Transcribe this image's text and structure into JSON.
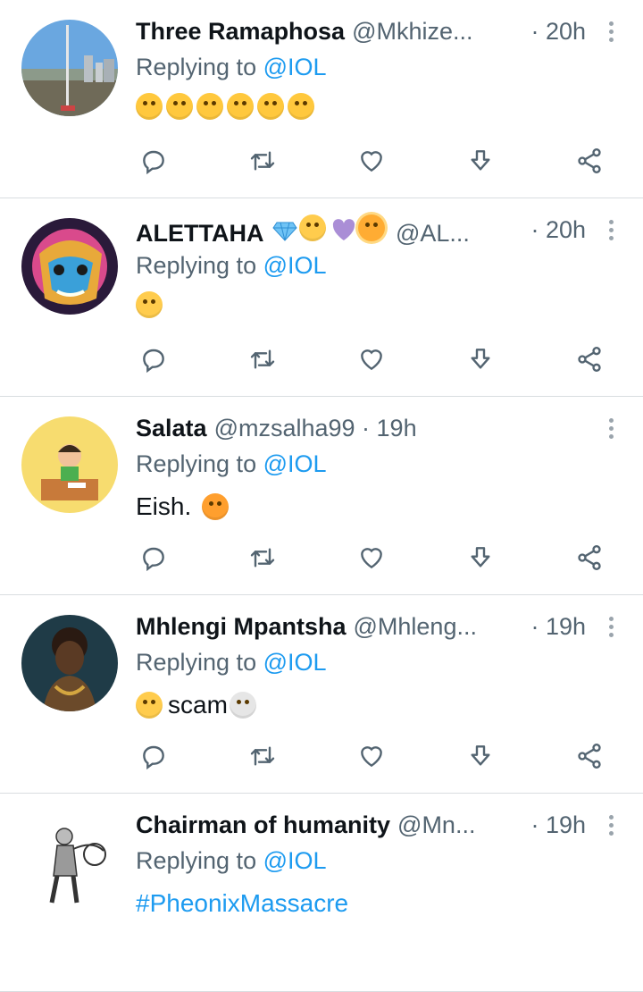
{
  "tweets": [
    {
      "name": "Three Ramaphosa",
      "handle": "@Mkhize...",
      "time": "· 20h",
      "reply_prefix": "Replying to",
      "reply_to": "@IOL",
      "body_text": "",
      "body_emojis": [
        "rolling-on-floor-laughing",
        "rolling-on-floor-laughing",
        "rolling-on-floor-laughing",
        "rolling-on-floor-laughing",
        "rolling-on-floor-laughing",
        "rolling-on-floor-laughing"
      ]
    },
    {
      "name": "ALETTAHA",
      "handle": "@AL...",
      "time": "· 20h",
      "reply_prefix": "Replying to",
      "reply_to": "@IOL",
      "body_text": "",
      "body_emojis": [
        "flushed-face"
      ]
    },
    {
      "name": "Salata",
      "handle": "@mzsalha99 · 19h",
      "time": "",
      "reply_prefix": "Replying to",
      "reply_to": "@IOL",
      "body_text": "Eish.",
      "body_emojis": [
        "face-with-hand-over-mouth"
      ]
    },
    {
      "name": "Mhlengi Mpantsha",
      "handle": "@Mhleng...",
      "time": "· 19h",
      "reply_prefix": "Replying to",
      "reply_to": "@IOL",
      "body_text": "scam",
      "body_emojis": [
        "loudly-crying-face",
        "skull"
      ]
    },
    {
      "name": "Chairman of humanity",
      "handle": "@Mn...",
      "time": "· 19h",
      "reply_prefix": "Replying to",
      "reply_to": "@IOL",
      "body_text": "#PheonixMassacre",
      "body_emojis": []
    }
  ],
  "icons": {
    "reply": "reply-icon",
    "retweet": "retweet-icon",
    "like": "like-icon",
    "download": "download-icon",
    "share": "share-icon",
    "more": "more-vertical-icon"
  },
  "colors": {
    "link": "#1d9bf0",
    "secondary_text": "#536471",
    "divider": "#d9dde0"
  }
}
